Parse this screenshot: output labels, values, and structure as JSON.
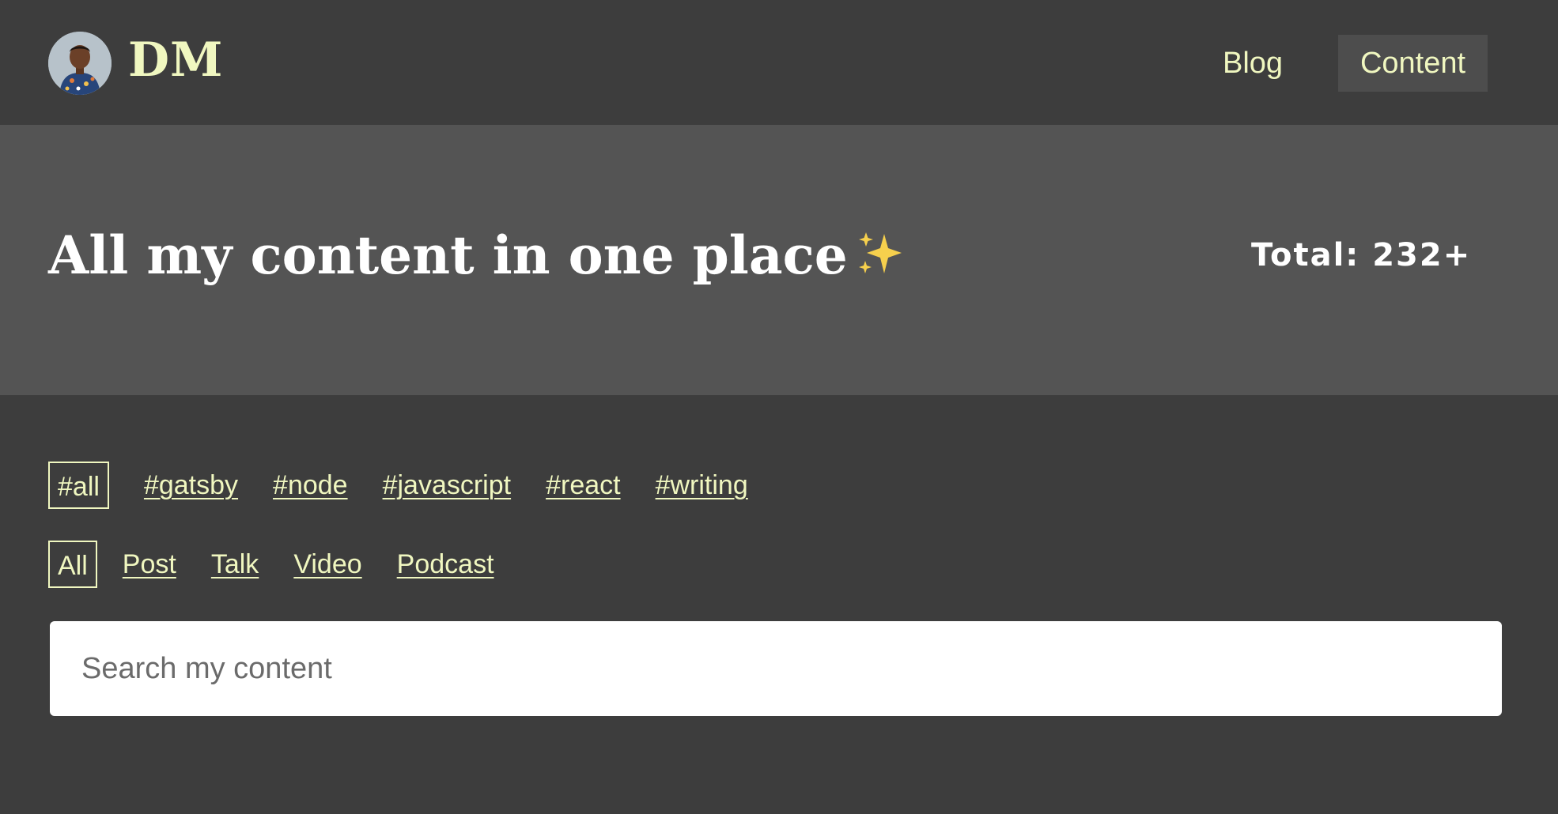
{
  "header": {
    "brand": "DM",
    "nav": [
      {
        "label": "Blog"
      },
      {
        "label": "Content"
      }
    ]
  },
  "hero": {
    "title": "All my content in one place",
    "total": "Total: 232+"
  },
  "filters": {
    "tags": [
      "#all",
      "#gatsby",
      "#node",
      "#javascript",
      "#react",
      "#writing"
    ],
    "active_tag": "#all",
    "types": [
      "All",
      "Post",
      "Talk",
      "Video",
      "Podcast"
    ],
    "active_type": "All"
  },
  "search": {
    "placeholder": "Search my content",
    "value": ""
  },
  "colors": {
    "background": "#3d3d3d",
    "hero_background": "#545454",
    "accent": "#f0f7c0",
    "active_nav_background": "#4d4d4d"
  },
  "icons": {
    "hero": "sparkles-icon"
  }
}
